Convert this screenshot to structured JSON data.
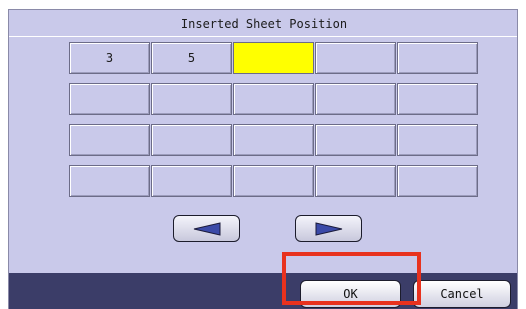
{
  "title": "Inserted Sheet Position",
  "grid": [
    [
      "3",
      "5",
      "",
      "",
      ""
    ],
    [
      "",
      "",
      "",
      "",
      ""
    ],
    [
      "",
      "",
      "",
      "",
      ""
    ],
    [
      "",
      "",
      "",
      "",
      ""
    ]
  ],
  "selected_cell": {
    "row": 1,
    "col": 3
  },
  "nav": {
    "prev_icon": "left-arrow-icon",
    "next_icon": "right-arrow-icon"
  },
  "buttons": {
    "ok": "OK",
    "cancel": "Cancel"
  },
  "colors": {
    "panel": "#c9c9ea",
    "selected": "#ffff00",
    "footer": "#3b3d68",
    "highlight": "#e8321e"
  }
}
